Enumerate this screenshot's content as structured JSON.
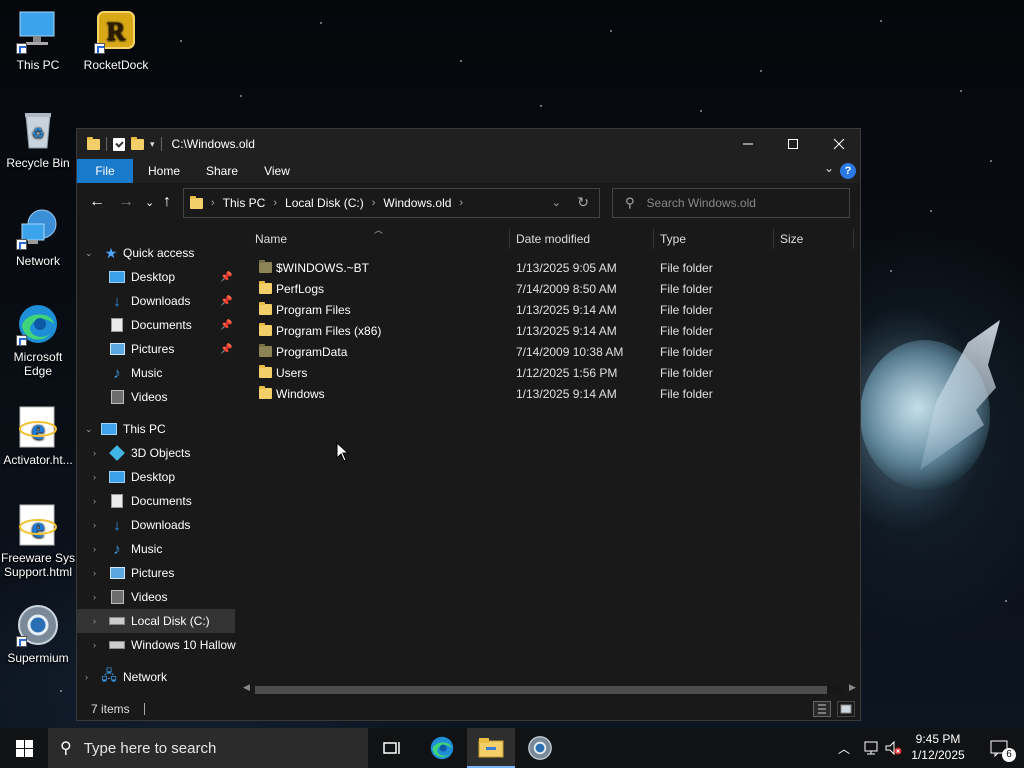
{
  "desktop": {
    "icons": [
      {
        "label": "This PC",
        "icon": "this-pc-icon"
      },
      {
        "label": "RocketDock",
        "icon": "rocketdock-icon"
      },
      {
        "label": "Recycle Bin",
        "icon": "recycle-bin-icon"
      },
      {
        "label": "Network",
        "icon": "network-icon"
      },
      {
        "label": "Microsoft Edge",
        "icon": "edge-icon"
      },
      {
        "label": "Activator.ht...",
        "icon": "ie-icon"
      },
      {
        "label": "Freeware Sys Support.html",
        "icon": "ie-icon"
      },
      {
        "label": "Supermium",
        "icon": "supermium-icon"
      }
    ]
  },
  "window": {
    "title": "C:\\Windows.old",
    "ribbon_tabs": [
      "File",
      "Home",
      "Share",
      "View"
    ],
    "address": {
      "crumbs": [
        "This PC",
        "Local Disk (C:)",
        "Windows.old"
      ]
    },
    "search_placeholder": "Search Windows.old",
    "nav": {
      "quick_access": "Quick access",
      "quick_items": [
        "Desktop",
        "Downloads",
        "Documents",
        "Pictures",
        "Music",
        "Videos"
      ],
      "this_pc": "This PC",
      "pc_items": [
        "3D Objects",
        "Desktop",
        "Documents",
        "Downloads",
        "Music",
        "Pictures",
        "Videos",
        "Local Disk (C:)",
        "Windows 10 Hallow"
      ],
      "network": "Network"
    },
    "columns": [
      "Name",
      "Date modified",
      "Type",
      "Size"
    ],
    "files": [
      {
        "name": "$WINDOWS.~BT",
        "date": "1/13/2025 9:05 AM",
        "type": "File folder",
        "hidden": true
      },
      {
        "name": "PerfLogs",
        "date": "7/14/2009 8:50 AM",
        "type": "File folder",
        "hidden": false
      },
      {
        "name": "Program Files",
        "date": "1/13/2025 9:14 AM",
        "type": "File folder",
        "hidden": false
      },
      {
        "name": "Program Files (x86)",
        "date": "1/13/2025 9:14 AM",
        "type": "File folder",
        "hidden": false
      },
      {
        "name": "ProgramData",
        "date": "7/14/2009 10:38 AM",
        "type": "File folder",
        "hidden": true
      },
      {
        "name": "Users",
        "date": "1/12/2025 1:56 PM",
        "type": "File folder",
        "hidden": false
      },
      {
        "name": "Windows",
        "date": "1/13/2025 9:14 AM",
        "type": "File folder",
        "hidden": false
      }
    ],
    "status": "7 items"
  },
  "taskbar": {
    "search_placeholder": "Type here to search",
    "time": "9:45 PM",
    "date": "1/12/2025",
    "notification_count": "6"
  },
  "colors": {
    "accent": "#1979ca",
    "folder": "#f3cf6a",
    "hidden_folder": "#8c8455",
    "window_bg": "#191919"
  }
}
